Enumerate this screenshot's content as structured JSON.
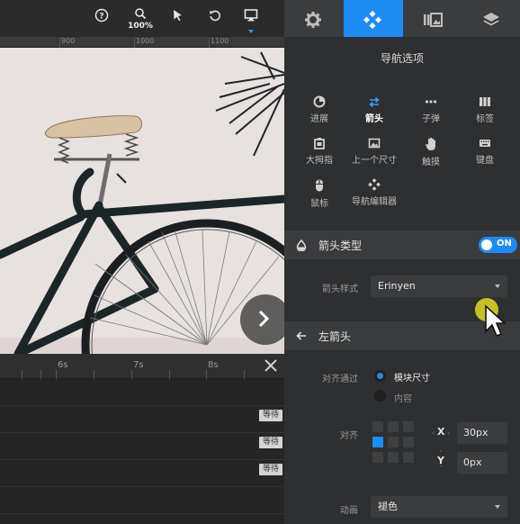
{
  "toolbar": {
    "zoom_label": "100%",
    "tools": [
      "help-icon",
      "zoom-icon",
      "select-pointer-icon",
      "undo-icon",
      "desktop-device-icon"
    ]
  },
  "ruler": {
    "labels": [
      "900",
      "1000",
      "1100"
    ]
  },
  "timeline": {
    "seconds": [
      "6s",
      "7s",
      "8s"
    ],
    "rows": [
      {
        "badge": "等待"
      },
      {
        "badge": "等待"
      },
      {
        "badge": "等待"
      }
    ]
  },
  "panel": {
    "tabs": [
      {
        "icon": "gear-icon"
      },
      {
        "icon": "navigation-icon",
        "active": true
      },
      {
        "icon": "slides-icon"
      },
      {
        "icon": "layers-icon"
      }
    ],
    "title": "导航选项",
    "nav_items": [
      {
        "label": "进展",
        "icon": "progress-icon"
      },
      {
        "label": "箭头",
        "icon": "arrows-icon",
        "active": true
      },
      {
        "label": "子弹",
        "icon": "bullets-icon"
      },
      {
        "label": "标签",
        "icon": "tabs-icon"
      },
      {
        "label": "大拇指",
        "icon": "thumbnails-icon"
      },
      {
        "label": "上一个尺寸",
        "icon": "image-icon"
      },
      {
        "label": "触摸",
        "icon": "touch-hand-icon"
      },
      {
        "label": "键盘",
        "icon": "keyboard-icon"
      },
      {
        "label": "鼠标",
        "icon": "mouse-icon"
      },
      {
        "label": "导航编辑器",
        "icon": "nav-editor-icon"
      }
    ],
    "arrow_type_section": {
      "title": "箭头类型",
      "toggle": "ON"
    },
    "arrow_style": {
      "label": "箭头样式",
      "value": "Erinyen"
    },
    "left_arrow_section": {
      "title": "左箭头"
    },
    "align_by": {
      "label": "对齐通过",
      "options": [
        {
          "label": "模块尺寸",
          "selected": true
        },
        {
          "label": "内容",
          "selected": false
        }
      ]
    },
    "align": {
      "label": "对齐",
      "x_label": "X",
      "y_label": "Y",
      "x_value": "30px",
      "y_value": "0px"
    },
    "animation": {
      "label": "动画",
      "value": "褪色"
    }
  },
  "colors": {
    "accent": "#1d8cf5",
    "panel_bg": "#2e2f31",
    "section_bg": "#3a3b3d",
    "cursor_highlight": "#d6d221"
  }
}
